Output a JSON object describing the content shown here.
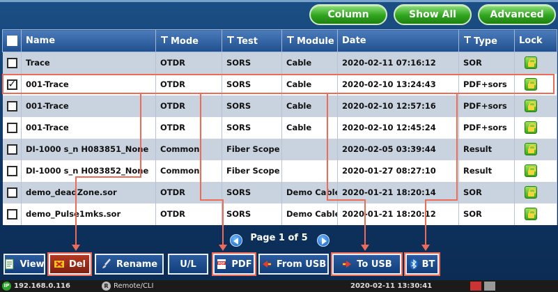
{
  "toolbar": {
    "column": "Column",
    "show_all": "Show All",
    "advanced": "Advanced"
  },
  "table": {
    "headers": {
      "name": "Name",
      "mode": "Mode",
      "test": "Test",
      "module": "Module",
      "date": "Date",
      "type": "Type",
      "lock": "Lock"
    },
    "rows": [
      {
        "checked": "",
        "name": "Trace",
        "mode": "OTDR",
        "test": "SORS",
        "module": "Cable",
        "date": "2020-02-11 07:16:12",
        "type": "SOR"
      },
      {
        "checked": "✓",
        "name": "001-Trace",
        "mode": "OTDR",
        "test": "SORS",
        "module": "Cable",
        "date": "2020-02-10 13:24:43",
        "type": "PDF+sors"
      },
      {
        "checked": "",
        "name": "001-Trace",
        "mode": "OTDR",
        "test": "SORS",
        "module": "Cable",
        "date": "2020-02-10 12:57:16",
        "type": "PDF+sors"
      },
      {
        "checked": "",
        "name": "001-Trace",
        "mode": "OTDR",
        "test": "SORS",
        "module": "Cable",
        "date": "2020-02-10 12:45:24",
        "type": "PDF+sors"
      },
      {
        "checked": "",
        "name": "DI-1000 s_n H083851_None",
        "mode": "Common",
        "test": "Fiber Scope",
        "module": "",
        "date": "2020-02-05 03:39:44",
        "type": "Result"
      },
      {
        "checked": "",
        "name": "DI-1000 s_n H083852_None",
        "mode": "Common",
        "test": "Fiber Scope",
        "module": "",
        "date": "2020-01-27 08:27:10",
        "type": "Result"
      },
      {
        "checked": "",
        "name": "demo_deadZone.sor",
        "mode": "OTDR",
        "test": "SORS",
        "module": "Demo Cable",
        "date": "2020-01-21 18:20:14",
        "type": "SOR"
      },
      {
        "checked": "",
        "name": "demo_Pulse1mks.sor",
        "mode": "OTDR",
        "test": "SORS",
        "module": "Demo Cable",
        "date": "2020-01-21 18:20:12",
        "type": "SOR"
      }
    ]
  },
  "pager": {
    "text": "Page 1 of 5"
  },
  "actions": {
    "view": "View",
    "del": "Del",
    "rename": "Rename",
    "ul": "U/L",
    "pdf": "PDF",
    "from_usb": "From USB",
    "to_usb": "To USB",
    "bt": "BT"
  },
  "status": {
    "ip_badge": "IP",
    "ip": "192.168.0.116",
    "remote_badge": "R",
    "remote": "Remote/CLI",
    "datetime": "2020-02-11  13:30:41"
  },
  "colors": {
    "accent": "#ee6b55",
    "header": "#1f4f8c",
    "green_button": "#2fa51d"
  }
}
